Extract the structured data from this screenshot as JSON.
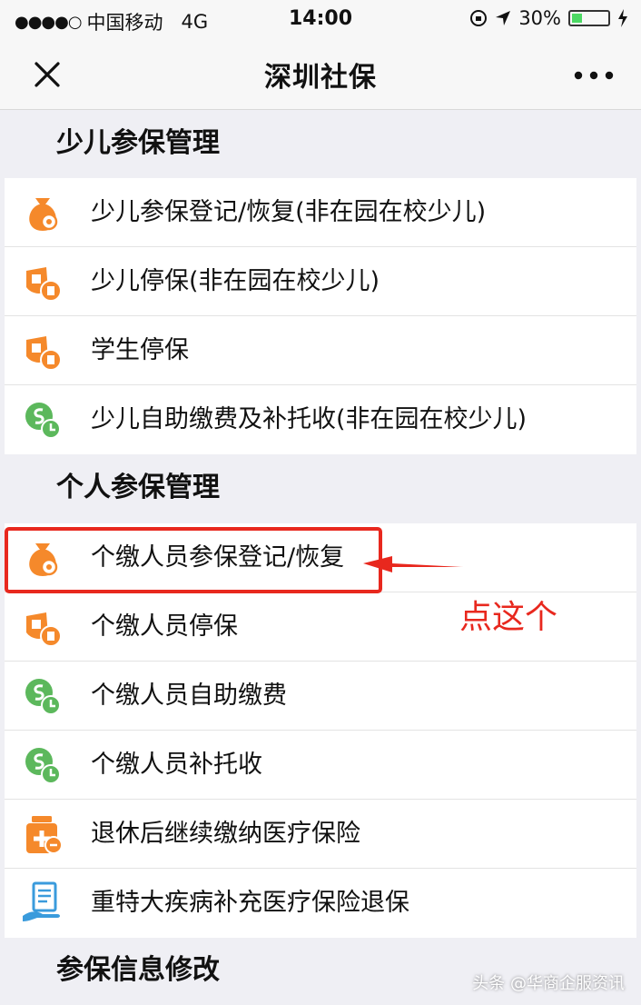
{
  "status_bar": {
    "carrier": "中国移动",
    "network": "4G",
    "time": "14:00",
    "battery": "30%",
    "battery_level": 0.3
  },
  "nav": {
    "title": "深圳社保",
    "close_icon": "close-icon",
    "more_icon": "more-icon"
  },
  "sections": [
    {
      "title": "少儿参保管理",
      "items": [
        {
          "label": "少儿参保登记/恢复(非在园在校少儿)",
          "icon": "money-bag-icon"
        },
        {
          "label": "少儿停保(非在园在校少儿)",
          "icon": "stop-insurance-icon"
        },
        {
          "label": "学生停保",
          "icon": "stop-insurance-icon"
        },
        {
          "label": "少儿自助缴费及补托收(非在园在校少儿)",
          "icon": "payment-clock-icon"
        }
      ]
    },
    {
      "title": "个人参保管理",
      "items": [
        {
          "label": "个缴人员参保登记/恢复",
          "icon": "money-bag-icon"
        },
        {
          "label": "个缴人员停保",
          "icon": "stop-insurance-icon"
        },
        {
          "label": "个缴人员自助缴费",
          "icon": "payment-clock-icon"
        },
        {
          "label": "个缴人员补托收",
          "icon": "payment-clock-icon"
        },
        {
          "label": "退休后继续缴纳医疗保险",
          "icon": "medicine-icon"
        },
        {
          "label": "重特大疾病补充医疗保险退保",
          "icon": "document-hand-icon"
        }
      ]
    },
    {
      "title": "参保信息修改",
      "items": []
    }
  ],
  "annotation": "点这个",
  "watermark": "头条 @华商企服资讯",
  "colors": {
    "orange": "#f5892b",
    "green": "#5cb85c",
    "blue": "#3a9bdc",
    "highlight_red": "#e8281e"
  }
}
